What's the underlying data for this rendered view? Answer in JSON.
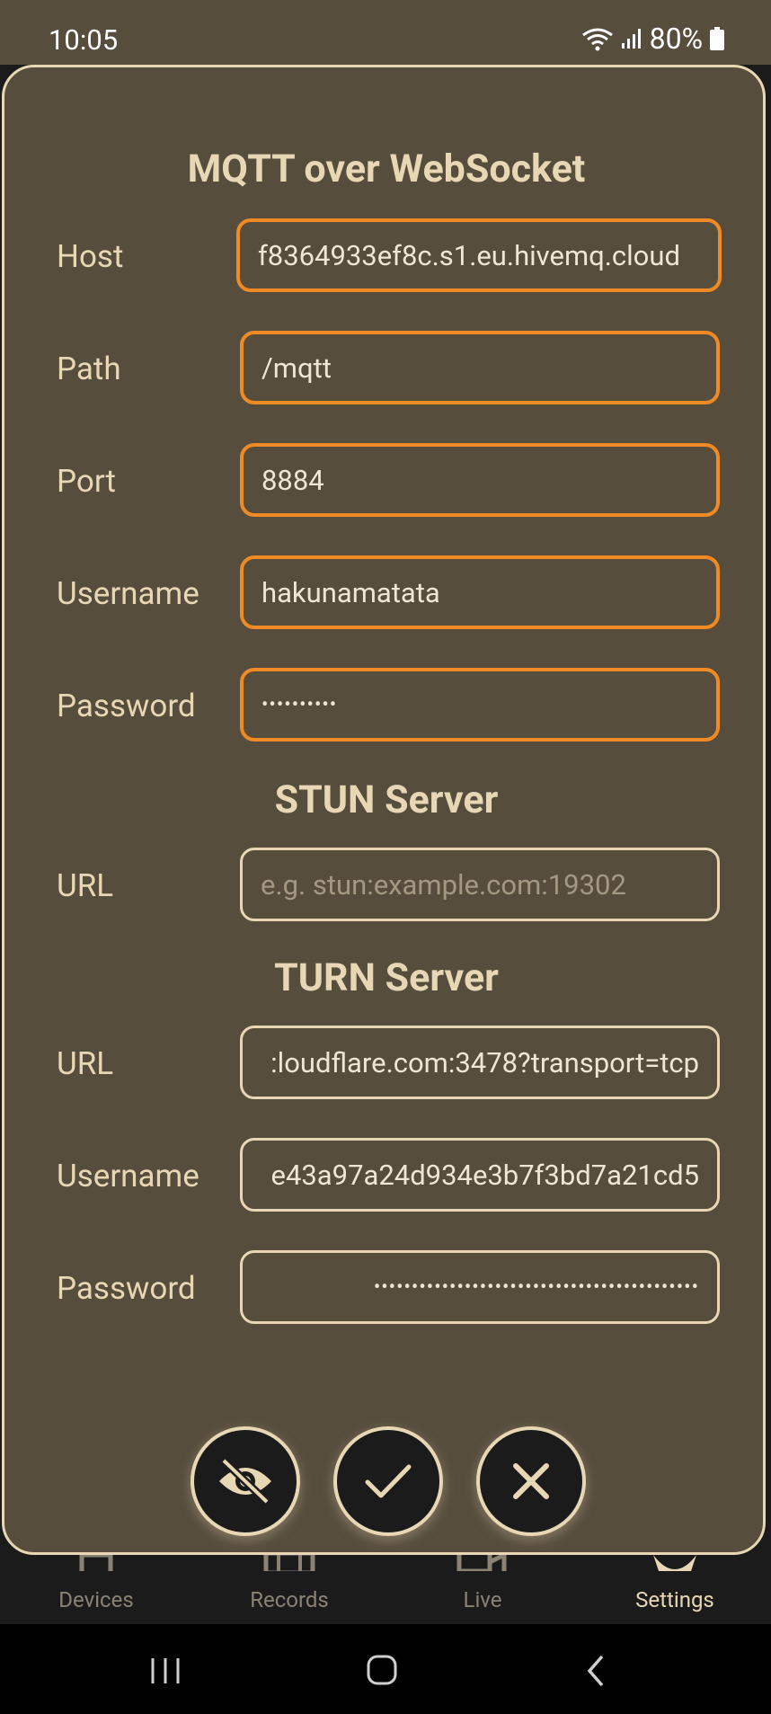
{
  "status_bar": {
    "time": "10:05",
    "battery": "80%"
  },
  "mqtt": {
    "title": "MQTT over WebSocket",
    "host_label": "Host",
    "host_value": "f8364933ef8c.s1.eu.hivemq.cloud",
    "path_label": "Path",
    "path_value": "/mqtt",
    "port_label": "Port",
    "port_value": "8884",
    "username_label": "Username",
    "username_value": "hakunamatata",
    "password_label": "Password",
    "password_value": "••••••••••"
  },
  "stun": {
    "title": "STUN Server",
    "url_label": "URL",
    "url_placeholder": "e.g. stun:example.com:19302"
  },
  "turn": {
    "title": "TURN Server",
    "url_label": "URL",
    "url_value": ":loudflare.com:3478?transport=tcp",
    "username_label": "Username",
    "username_value": "e43a97a24d934e3b7f3bd7a21cd5",
    "password_label": "Password",
    "password_value": "•••••••••••••••••••••••••••••••••••••••••••"
  },
  "actions": {
    "toggle_visibility_icon": "eye-slash-icon",
    "confirm_icon": "check-icon",
    "cancel_icon": "close-icon"
  },
  "bottom_nav": {
    "items": [
      {
        "label": "Devices",
        "icon": "home-icon"
      },
      {
        "label": "Records",
        "icon": "film-icon"
      },
      {
        "label": "Live",
        "icon": "video-camera-icon"
      },
      {
        "label": "Settings",
        "icon": "gear-icon"
      }
    ]
  },
  "colors": {
    "accent": "#e8d7b4",
    "focus_border": "#f08a24",
    "dialog_bg": "#574d3d",
    "nav_bg": "#1b1b1b"
  }
}
